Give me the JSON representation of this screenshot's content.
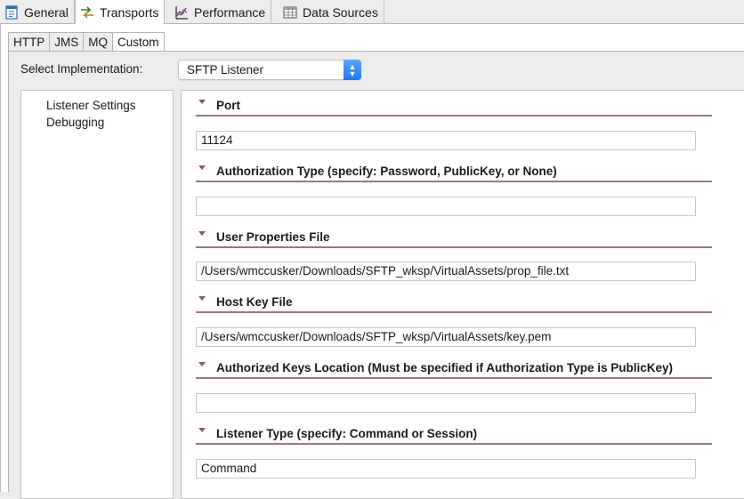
{
  "top_tabs": [
    {
      "label": "General",
      "icon": "general-doc-icon"
    },
    {
      "label": "Transports",
      "icon": "transports-arrows-icon",
      "active": true
    },
    {
      "label": "Performance",
      "icon": "performance-chart-icon"
    },
    {
      "label": "Data Sources",
      "icon": "data-sources-table-icon"
    }
  ],
  "sub_tabs": [
    {
      "label": "HTTP"
    },
    {
      "label": "JMS"
    },
    {
      "label": "MQ"
    },
    {
      "label": "Custom",
      "active": true
    }
  ],
  "implementation": {
    "label": "Select Implementation:",
    "value": "SFTP Listener"
  },
  "nav": [
    {
      "label": "Listener Settings"
    },
    {
      "label": "Debugging"
    }
  ],
  "sections": [
    {
      "title": "Port",
      "value": "11124"
    },
    {
      "title": "Authorization Type (specify: Password, PublicKey, or None)",
      "value": ""
    },
    {
      "title": "User Properties File",
      "value": "/Users/wmccusker/Downloads/SFTP_wksp/VirtualAssets/prop_file.txt"
    },
    {
      "title": "Host Key File",
      "value": "/Users/wmccusker/Downloads/SFTP_wksp/VirtualAssets/key.pem"
    },
    {
      "title": "Authorized Keys Location (Must be specified if Authorization Type is PublicKey)",
      "value": ""
    },
    {
      "title": "Listener Type (specify: Command or Session)",
      "value": "Command"
    }
  ],
  "colors": {
    "section_rule": "#9c7777",
    "select_arrow": "#1f76f3"
  }
}
